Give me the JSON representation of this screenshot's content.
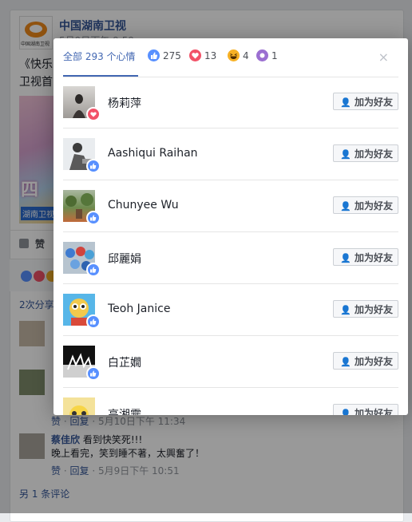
{
  "background": {
    "page_name": "中国湖南卫视",
    "logo_text": "中国湖南卫视",
    "post_date": "5月9日下午 9:59",
    "post_text": "《快乐 卫视首",
    "image_text": "四",
    "image_label": "湖南卫视",
    "like_label": "赞",
    "share_text": "2次分享",
    "comments": [
      {
        "name": "",
        "text": "",
        "meta_like": "赞",
        "meta_reply": "回复",
        "meta_time": "· 5月10日下午 11:34"
      },
      {
        "name": "蔡佳欣",
        "line1": "看到快笑死!!!",
        "line2": "晚上看完，笑到睡不著，太興奮了！",
        "meta_like": "赞",
        "meta_reply": "回复",
        "meta_time": "· 5月9日下午 10:51"
      }
    ],
    "more_comments": "另 1 条评论"
  },
  "dialog": {
    "tabs": [
      {
        "label": "全部 293 个心情",
        "active": true
      },
      {
        "icon": "like-icon",
        "count": "275"
      },
      {
        "icon": "love-icon",
        "count": "13"
      },
      {
        "icon": "haha-icon",
        "count": "4"
      },
      {
        "icon": "wow-icon",
        "count": "1"
      }
    ],
    "close_label": "×",
    "add_friend_label": "加为好友",
    "people": [
      {
        "name": "杨莉萍",
        "reaction": "love"
      },
      {
        "name": "Aashiqui Raihan",
        "reaction": "like"
      },
      {
        "name": "Chunyee Wu",
        "reaction": "like"
      },
      {
        "name": "邱麗娟",
        "reaction": "like"
      },
      {
        "name": "Teoh Janice",
        "reaction": "like"
      },
      {
        "name": "白芷嫺",
        "reaction": "like"
      },
      {
        "name": "高湘霙",
        "reaction": "like"
      }
    ]
  },
  "colors": {
    "accent": "#4267b2",
    "like": "#5890ff",
    "love": "#f25268",
    "haha": "#f7b125"
  }
}
